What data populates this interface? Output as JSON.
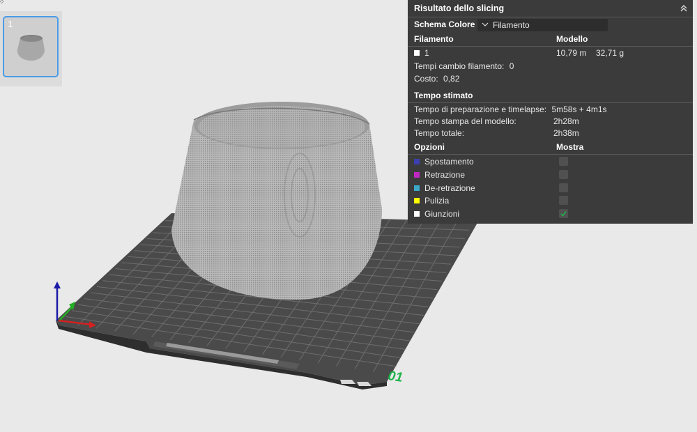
{
  "thumbnail": {
    "index": "1"
  },
  "bed": {
    "plate_number": "01"
  },
  "panel": {
    "title": "Risultato dello slicing",
    "scheme_label": "Schema Colore",
    "scheme_value": "Filamento",
    "filament_header": "Filamento",
    "model_header": "Modello",
    "filament": {
      "id": "1",
      "length": "10,79 m",
      "weight": "32,71 g",
      "color": "#ffffff"
    },
    "changes_label": "Tempi cambio filamento:",
    "changes_value": "0",
    "cost_label": "Costo:",
    "cost_value": "0,82",
    "time_header": "Tempo stimato",
    "prep_label": "Tempo di preparazione e timelapse:",
    "prep_value": "5m58s + 4m1s",
    "model_time_label": "Tempo stampa del modello:",
    "model_time_value": "2h28m",
    "total_label": "Tempo totale:",
    "total_value": "2h38m",
    "options_header": "Opzioni",
    "show_header": "Mostra",
    "options": [
      {
        "label": "Spostamento",
        "color": "#3b3fb0",
        "checked": false
      },
      {
        "label": "Retrazione",
        "color": "#c227c4",
        "checked": false
      },
      {
        "label": "De-retrazione",
        "color": "#3da9c9",
        "checked": false
      },
      {
        "label": "Pulizia",
        "color": "#ffff00",
        "checked": false
      },
      {
        "label": "Giunzioni",
        "color": "#ffffff",
        "checked": true
      }
    ]
  }
}
